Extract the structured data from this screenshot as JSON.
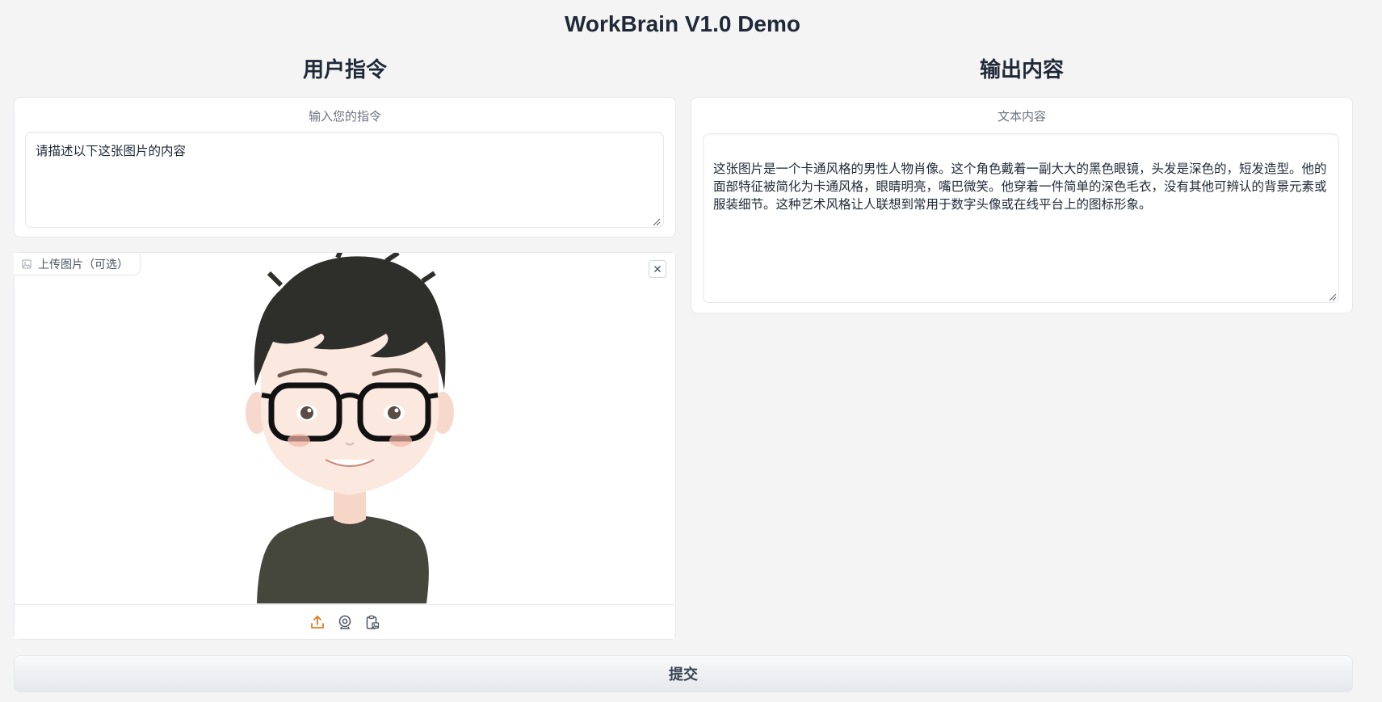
{
  "app": {
    "title": "WorkBrain V1.0 Demo"
  },
  "left": {
    "heading": "用户指令",
    "instruction": {
      "label": "输入您的指令",
      "value": "请描述以下这张图片的内容"
    },
    "image_upload": {
      "label": "上传图片（可选）",
      "image_icon": "image-icon",
      "clear_icon": "close-icon",
      "toolbar_icons": [
        "upload-icon",
        "webcam-icon",
        "clipboard-icon"
      ]
    }
  },
  "right": {
    "heading": "输出内容",
    "output": {
      "label": "文本内容",
      "value": "这张图片是一个卡通风格的男性人物肖像。这个角色戴着一副大大的黑色眼镜，头发是深色的，短发造型。他的面部特征被简化为卡通风格，眼睛明亮，嘴巴微笑。他穿着一件简单的深色毛衣，没有其他可辨认的背景元素或服装细节。这种艺术风格让人联想到常用于数字头像或在线平台上的图标形象。"
    }
  },
  "submit": {
    "label": "提交"
  },
  "colors": {
    "page_bg": "#f4f4f5",
    "panel_bg": "#ffffff",
    "accent_orange": "#e07b20",
    "border": "#e5e7eb"
  }
}
